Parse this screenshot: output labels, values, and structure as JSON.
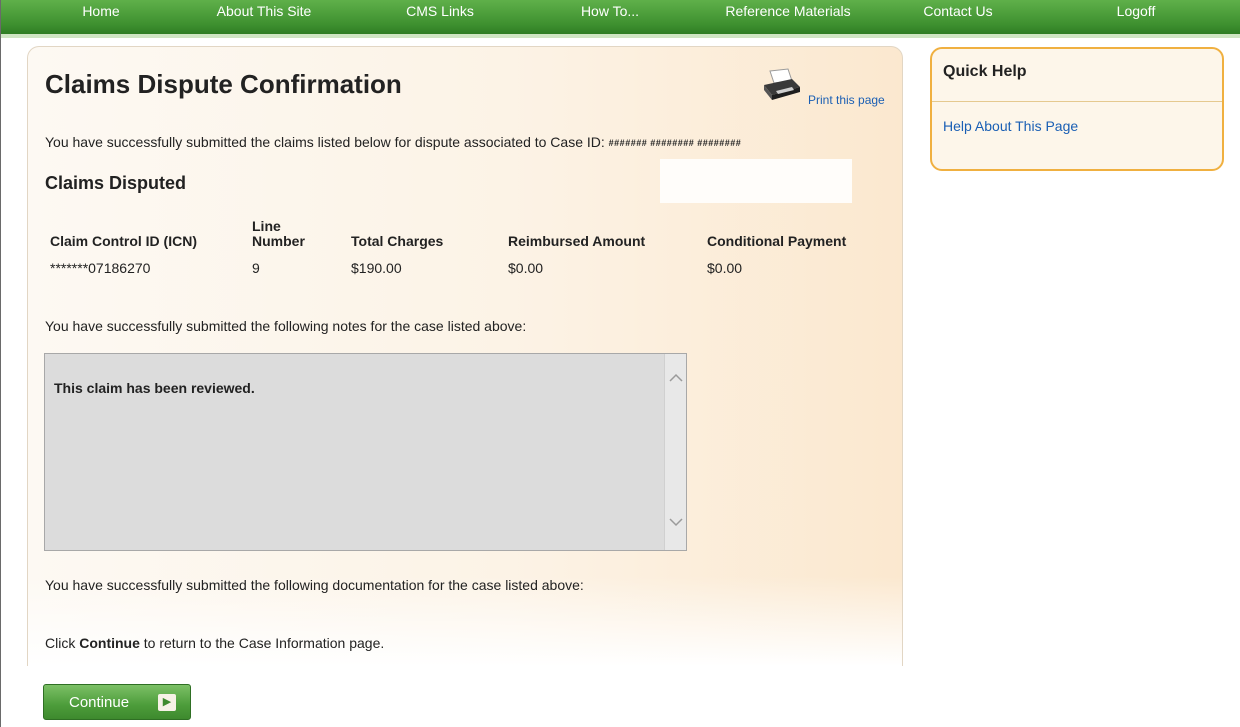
{
  "nav": {
    "items": [
      "Home",
      "About This Site",
      "CMS Links",
      "How To...",
      "Reference Materials",
      "Contact Us",
      "Logoff"
    ]
  },
  "page": {
    "title": "Claims Dispute Confirmation",
    "print_label": "Print this page",
    "success_claims_msg": "You have successfully submitted the claims listed below for dispute associated to Case ID:",
    "case_id": "####### ######## ########",
    "claims_heading": "Claims Disputed",
    "notes_msg": "You have successfully submitted the following notes for the case listed above:",
    "notes_text": "This claim has been reviewed.",
    "docs_msg": "You have successfully submitted the following documentation for the case listed above:",
    "continue_prefix": "Click ",
    "continue_bold": "Continue",
    "continue_suffix": " to return to the Case Information page."
  },
  "claims_table": {
    "headers": [
      "Claim Control ID (ICN)",
      "Line Number",
      "Total Charges",
      "Reimbursed Amount",
      "Conditional Payment"
    ],
    "rows": [
      [
        "*******07186270",
        "9",
        "$190.00",
        "$0.00",
        "$0.00"
      ]
    ]
  },
  "quick_help": {
    "title": "Quick Help",
    "link": "Help About This Page"
  },
  "buttons": {
    "continue_label": "Continue"
  },
  "icons": {
    "print": "printer-icon",
    "continue_arrow": "arrow-right-icon",
    "scroll_up": "chevron-up-icon",
    "scroll_down": "chevron-down-icon"
  },
  "colors": {
    "nav_green": "#3f9130",
    "link_blue": "#1a5fb4",
    "help_border": "#f0b040",
    "button_green": "#4c9c3a"
  }
}
